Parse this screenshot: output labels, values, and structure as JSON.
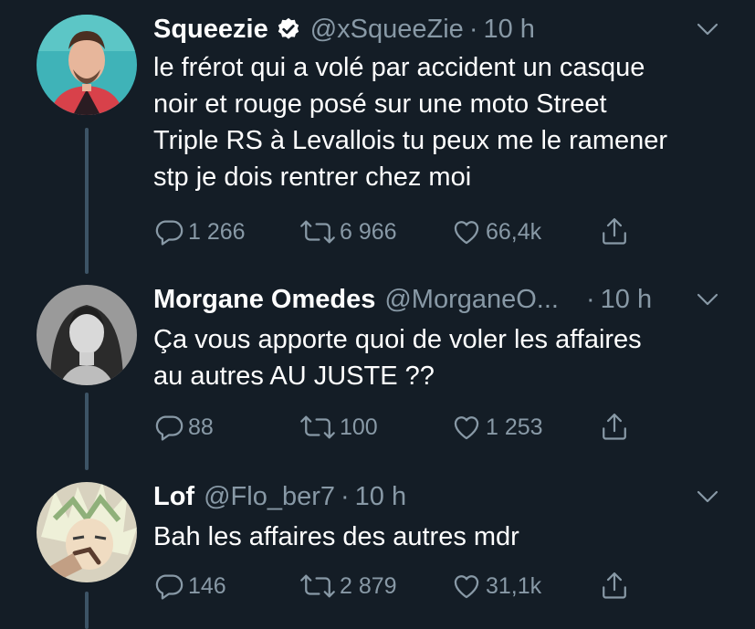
{
  "tweets": [
    {
      "name": "Squeezie",
      "handle": "@xSqueeZie",
      "dot": "·",
      "time": "10 h",
      "lines": [
        "le frérot qui a volé par accident un casque",
        "noir et rouge posé sur une moto Street",
        "Triple RS à Levallois tu peux me le ramener",
        "stp je dois rentrer chez moi"
      ],
      "replies": "1 266",
      "retweets": "6 966",
      "likes": "66,4k"
    },
    {
      "name": "Morgane Omedes",
      "handle": "@MorganeO...",
      "dot": "·",
      "time": "10 h",
      "lines": [
        "Ça vous apporte quoi de voler les affaires",
        "au autres AU JUSTE ??"
      ],
      "replies": "88",
      "retweets": "100",
      "likes": "1 253"
    },
    {
      "name": "Lof",
      "handle": "@Flo_ber7",
      "dot": "·",
      "time": "10 h",
      "lines": [
        "Bah les affaires des autres mdr"
      ],
      "replies": "146",
      "retweets": "2 879",
      "likes": "31,1k"
    }
  ],
  "icons": {
    "reply": "reply-icon",
    "retweet": "retweet-icon",
    "like": "heart-icon",
    "share": "share-icon",
    "verified": "verified-badge-icon",
    "menu": "chevron-down-icon"
  },
  "colors": {
    "background": "#141d26",
    "text": "#ffffff",
    "secondary": "#8899a6",
    "thread_line": "#3d5466"
  }
}
